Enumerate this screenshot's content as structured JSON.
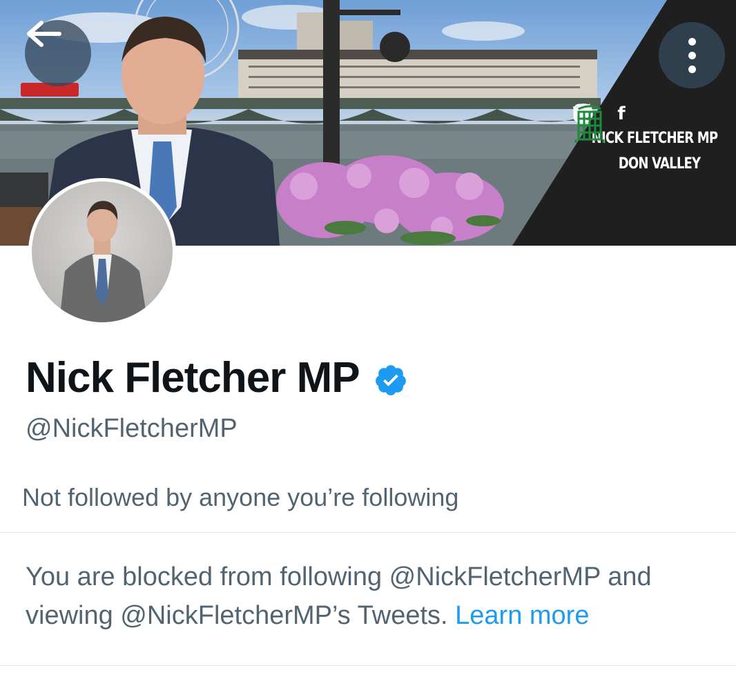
{
  "banner": {
    "brand_line1": "NICK FLETCHER MP",
    "brand_line2": "DON VALLEY",
    "social_icons": [
      "facebook-icon",
      "instagram-icon",
      "twitter-icon",
      "globe-icon"
    ],
    "social_glyphs": {
      "facebook": "f",
      "instagram": "◎",
      "twitter": "🐦",
      "globe": "⊕"
    }
  },
  "header_buttons": {
    "back_icon": "arrow-left-icon",
    "more_icon": "more-vertical-icon"
  },
  "profile": {
    "display_name": "Nick Fletcher MP",
    "handle": "@NickFletcherMP",
    "followers_you_know": "Not followed by anyone you’re following",
    "verified_icon": "verified-badge-icon"
  },
  "block_notice": {
    "text": "You are blocked from following @NickFletcherMP and viewing @NickFletcherMP’s Tweets. ",
    "link_label": "Learn more"
  },
  "colors": {
    "link": "#1d9bf0",
    "secondary_text": "#536471",
    "primary_text": "#0f1419",
    "verified": "#1d9bf0"
  }
}
